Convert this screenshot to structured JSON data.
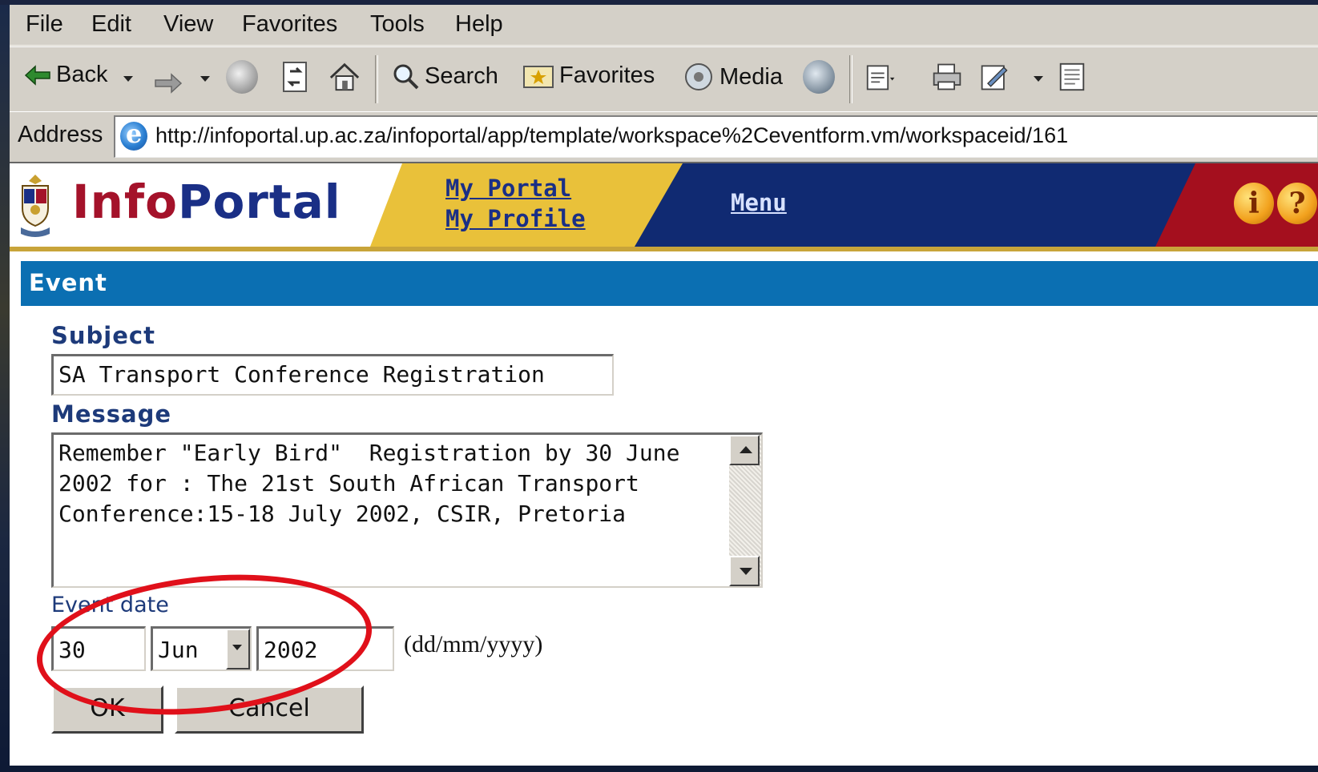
{
  "menubar": {
    "items": [
      "File",
      "Edit",
      "View",
      "Favorites",
      "Tools",
      "Help"
    ]
  },
  "toolbar": {
    "back_label": "Back",
    "search_label": "Search",
    "favorites_label": "Favorites",
    "media_label": "Media"
  },
  "address": {
    "label": "Address",
    "url": "http://infoportal.up.ac.za/infoportal/app/template/workspace%2Ceventform.vm/workspaceid/161"
  },
  "header": {
    "logo_info": "Info",
    "logo_portal": "Portal",
    "my_portal": "My Portal",
    "my_profile": "My Profile",
    "menu": "Menu",
    "info_icon": "i",
    "help_icon": "?"
  },
  "form": {
    "title": "Event",
    "subject_label": "Subject",
    "subject_value": "SA Transport Conference Registration",
    "message_label": "Message",
    "message_value": "Remember \"Early Bird\"  Registration by 30 June 2002 for : The 21st South African Transport Conference:15-18 July 2002, CSIR, Pretoria",
    "event_date_label": "Event date",
    "day_value": "30",
    "month_value": "Jun",
    "year_value": "2002",
    "date_format": "(dd/mm/yyyy)",
    "ok_label": "OK",
    "cancel_label": "Cancel"
  },
  "annotation": {
    "circle_color": "#e0101a"
  },
  "colors": {
    "brand_red": "#a4122a",
    "brand_blue": "#1a2f86",
    "section_blue": "#0b6fb2",
    "header_yellow": "#e9c13a"
  }
}
